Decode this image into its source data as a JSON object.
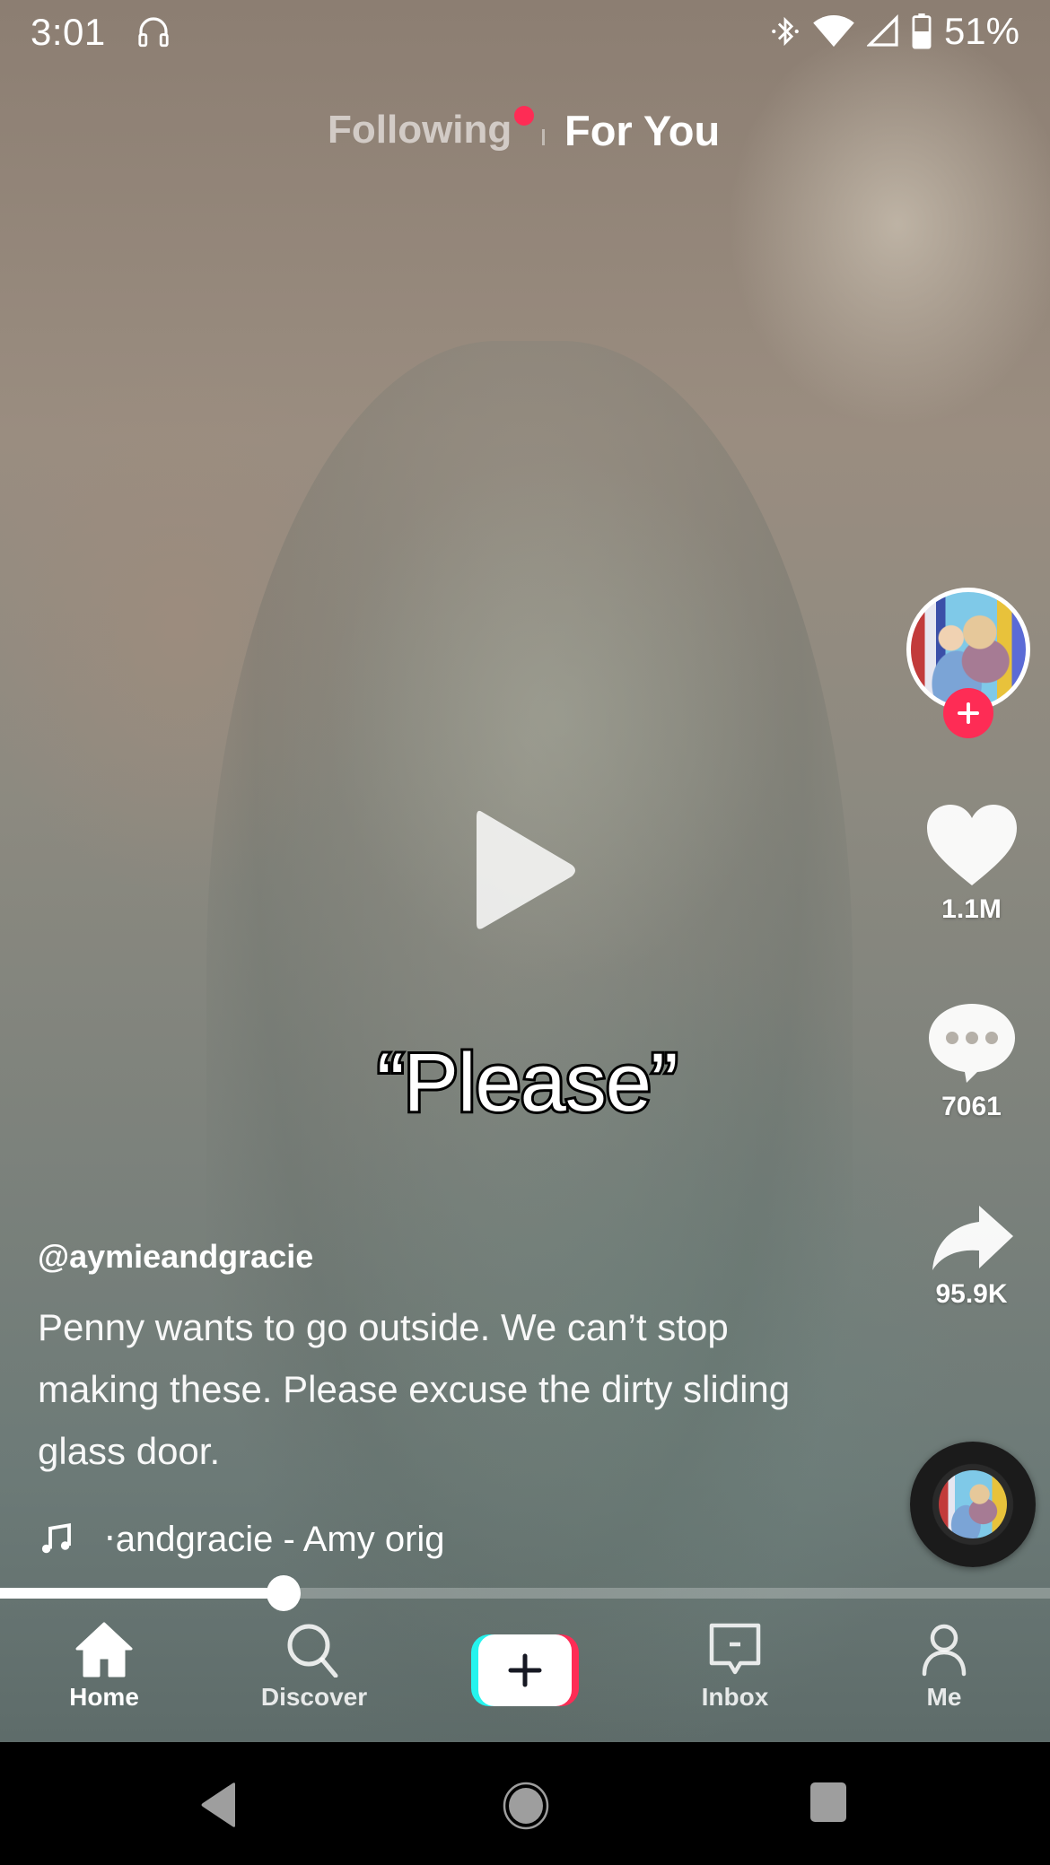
{
  "status_bar": {
    "time": "3:01",
    "left_icons": [
      "headphones-icon"
    ],
    "right_icons": [
      "bluetooth-icon",
      "wifi-icon",
      "cell-signal-icon",
      "battery-icon"
    ],
    "battery_percent": "51%"
  },
  "top_tabs": {
    "following_label": "Following",
    "following_has_notification": true,
    "for_you_label": "For You",
    "active_tab": "For You"
  },
  "video": {
    "paused": true,
    "caption_overlay": "“Please”",
    "progress_percent": 27
  },
  "right_rail": {
    "creator_avatar": "creator-avatar",
    "follow_icon": "plus-icon",
    "likes": "1.1M",
    "comments": "7061",
    "shares": "95.9K"
  },
  "post": {
    "username": "@aymieandgracie",
    "description": "Penny wants to go outside. We can’t stop making these. Please excuse the dirty sliding glass door.",
    "music_text": "‧andgracie - Amy    orig"
  },
  "bottom_nav": {
    "items": [
      {
        "label": "Home",
        "icon": "home-icon",
        "active": true
      },
      {
        "label": "Discover",
        "icon": "search-icon",
        "active": false
      },
      {
        "label": "",
        "icon": "plus-icon",
        "active": false
      },
      {
        "label": "Inbox",
        "icon": "inbox-icon",
        "active": false
      },
      {
        "label": "Me",
        "icon": "profile-icon",
        "active": false
      }
    ]
  },
  "colors": {
    "accent_red": "#fe2c55",
    "accent_cyan": "#25f4ee",
    "system_nav_icon": "#9e9e9e"
  },
  "android_nav": {
    "buttons": [
      "back",
      "home",
      "recents"
    ]
  }
}
